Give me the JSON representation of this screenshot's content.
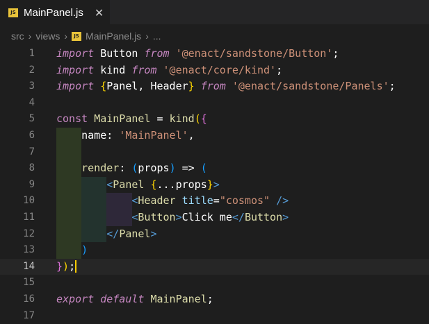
{
  "tab": {
    "icon_label": "JS",
    "title": "MainPanel.js",
    "close": "✕"
  },
  "breadcrumb": {
    "items": [
      "src",
      "views",
      "MainPanel.js",
      "..."
    ],
    "separator": "›",
    "icon_label": "JS"
  },
  "lines": [
    {
      "n": "1",
      "tokens": [
        [
          "kw",
          "import"
        ],
        [
          "plain",
          " Button "
        ],
        [
          "kw",
          "from"
        ],
        [
          "plain",
          " "
        ],
        [
          "str",
          "'@enact/sandstone/Button'"
        ],
        [
          "plain",
          ";"
        ]
      ]
    },
    {
      "n": "2",
      "tokens": [
        [
          "kw",
          "import"
        ],
        [
          "plain",
          " kind "
        ],
        [
          "kw",
          "from"
        ],
        [
          "plain",
          " "
        ],
        [
          "str",
          "'@enact/core/kind'"
        ],
        [
          "plain",
          ";"
        ]
      ]
    },
    {
      "n": "3",
      "tokens": [
        [
          "kw",
          "import"
        ],
        [
          "plain",
          " "
        ],
        [
          "br1",
          "{"
        ],
        [
          "plain",
          "Panel, Header"
        ],
        [
          "br1",
          "}"
        ],
        [
          "plain",
          " "
        ],
        [
          "kw",
          "from"
        ],
        [
          "plain",
          " "
        ],
        [
          "str",
          "'@enact/sandstone/Panels'"
        ],
        [
          "plain",
          ";"
        ]
      ]
    },
    {
      "n": "4",
      "tokens": []
    },
    {
      "n": "5",
      "tokens": [
        [
          "kwn",
          "const"
        ],
        [
          "plain",
          " "
        ],
        [
          "def",
          "MainPanel"
        ],
        [
          "plain",
          " = "
        ],
        [
          "def",
          "kind"
        ],
        [
          "br1",
          "("
        ],
        [
          "br2",
          "{"
        ]
      ]
    },
    {
      "n": "6",
      "tokens": [
        [
          "plain",
          "    name: "
        ],
        [
          "str",
          "'MainPanel'"
        ],
        [
          "plain",
          ","
        ]
      ]
    },
    {
      "n": "7",
      "tokens": []
    },
    {
      "n": "8",
      "tokens": [
        [
          "plain",
          "    "
        ],
        [
          "def",
          "render"
        ],
        [
          "plain",
          ": "
        ],
        [
          "br3",
          "("
        ],
        [
          "plain",
          "props"
        ],
        [
          "br3",
          ")"
        ],
        [
          "plain",
          " => "
        ],
        [
          "br3",
          "("
        ]
      ]
    },
    {
      "n": "9",
      "tokens": [
        [
          "plain",
          "        "
        ],
        [
          "tag",
          "<"
        ],
        [
          "def",
          "Panel"
        ],
        [
          "plain",
          " "
        ],
        [
          "br1",
          "{"
        ],
        [
          "plain",
          "...props"
        ],
        [
          "br1",
          "}"
        ],
        [
          "tag",
          ">"
        ]
      ]
    },
    {
      "n": "10",
      "tokens": [
        [
          "plain",
          "            "
        ],
        [
          "tag",
          "<"
        ],
        [
          "def",
          "Header"
        ],
        [
          "plain",
          " "
        ],
        [
          "attr",
          "title"
        ],
        [
          "plain",
          "="
        ],
        [
          "str",
          "\"cosmos\""
        ],
        [
          "plain",
          " "
        ],
        [
          "tag",
          "/>"
        ]
      ]
    },
    {
      "n": "11",
      "tokens": [
        [
          "plain",
          "            "
        ],
        [
          "tag",
          "<"
        ],
        [
          "def",
          "Button"
        ],
        [
          "tag",
          ">"
        ],
        [
          "plain",
          "Click me"
        ],
        [
          "tag",
          "</"
        ],
        [
          "def",
          "Button"
        ],
        [
          "tag",
          ">"
        ]
      ]
    },
    {
      "n": "12",
      "tokens": [
        [
          "plain",
          "        "
        ],
        [
          "tag",
          "</"
        ],
        [
          "def",
          "Panel"
        ],
        [
          "tag",
          ">"
        ]
      ]
    },
    {
      "n": "13",
      "tokens": [
        [
          "plain",
          "    "
        ],
        [
          "br3",
          ")"
        ]
      ]
    },
    {
      "n": "14",
      "tokens": [
        [
          "br2",
          "}"
        ],
        [
          "br1",
          ")"
        ],
        [
          "plain",
          ";"
        ]
      ],
      "current": true
    },
    {
      "n": "15",
      "tokens": []
    },
    {
      "n": "16",
      "tokens": [
        [
          "kw",
          "export"
        ],
        [
          "plain",
          " "
        ],
        [
          "kw",
          "default"
        ],
        [
          "plain",
          " "
        ],
        [
          "def",
          "MainPanel"
        ],
        [
          "plain",
          ";"
        ]
      ]
    },
    {
      "n": "17",
      "tokens": []
    }
  ],
  "colors": {
    "background": "#1e1e1e",
    "keyword": "#c586c0",
    "string": "#ce9178",
    "function": "#dcdcaa",
    "tag": "#569cd6",
    "attribute": "#9cdcfe",
    "js_icon": "#e8c33a"
  }
}
